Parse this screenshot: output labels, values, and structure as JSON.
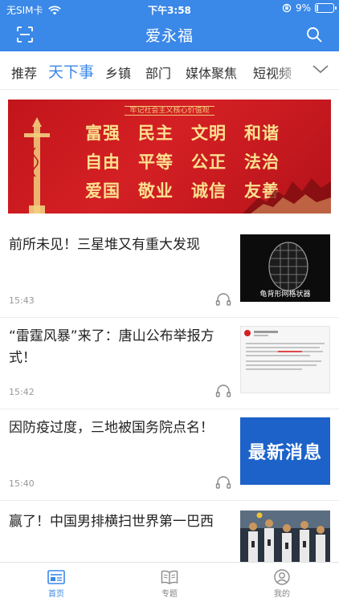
{
  "status_bar": {
    "carrier": "无SIM卡",
    "time": "下午3:58",
    "battery": "9%",
    "battery_level": 0.09
  },
  "header": {
    "title": "爱永福",
    "scan_icon": "scan-icon",
    "search_icon": "search-icon"
  },
  "tabs": [
    {
      "label": "推荐",
      "active": false
    },
    {
      "label": "天下事",
      "active": true
    },
    {
      "label": "乡镇",
      "active": false
    },
    {
      "label": "部门",
      "active": false
    },
    {
      "label": "媒体聚焦",
      "active": false
    },
    {
      "label": "短视频",
      "active": false
    }
  ],
  "banner": {
    "subtitle": "牢记社会主义核心价值观",
    "rows": [
      [
        "富强",
        "民主",
        "文明",
        "和谐"
      ],
      [
        "自由",
        "平等",
        "公正",
        "法治"
      ],
      [
        "爱国",
        "敬业",
        "诚信",
        "友善"
      ]
    ]
  },
  "news": [
    {
      "headline": "前所未见！三星堆又有重大发现",
      "time": "15:43",
      "thumb_caption": "龟背形网格状器"
    },
    {
      "headline": "“雷霆风暴”来了：唐山公布举报方式！",
      "time": "15:42"
    },
    {
      "headline": "因防疫过度，三地被国务院点名！",
      "time": "15:40",
      "thumb_text": "最新消息"
    },
    {
      "headline": "赢了！中国男排横扫世界第一巴西",
      "time": ""
    }
  ],
  "tabbar": [
    {
      "label": "首页",
      "icon": "news-icon",
      "active": true
    },
    {
      "label": "专题",
      "icon": "book-icon",
      "active": false
    },
    {
      "label": "我的",
      "icon": "profile-icon",
      "active": false
    }
  ],
  "colors": {
    "primary": "#3a88e8",
    "banner_red": "#c1151b",
    "banner_gold": "#fbe08f"
  }
}
